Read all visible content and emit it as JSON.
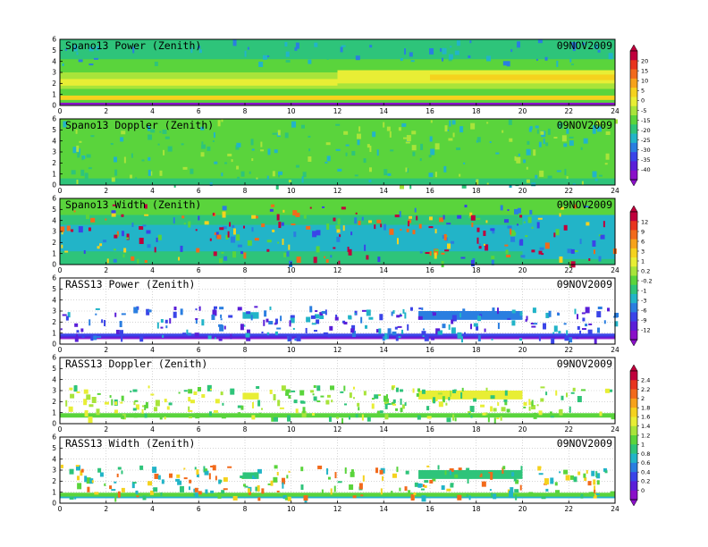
{
  "chart_data": {
    "type": "heatmap",
    "date_label": "09NOV2009",
    "x_ticks": [
      0,
      2,
      4,
      6,
      8,
      10,
      12,
      14,
      16,
      18,
      20,
      22,
      24
    ],
    "y_ticks": [
      0,
      1,
      2,
      3,
      4,
      5,
      6
    ],
    "xlim": [
      0,
      24
    ],
    "ylim": [
      0,
      6
    ],
    "colorbars": [
      {
        "id": "spano",
        "ticks": [
          "20",
          "15",
          "10",
          "5",
          "0",
          "-5",
          "-15",
          "-20",
          "-25",
          "-30",
          "-35",
          "-40"
        ],
        "colors": [
          "#c0003c",
          "#e8341e",
          "#f26a1b",
          "#f7a21b",
          "#f5d21e",
          "#e8ee35",
          "#a8e43a",
          "#5ad43c",
          "#2ec47a",
          "#22b4c8",
          "#2a7ee0",
          "#3a44e8",
          "#5a1ed8",
          "#8a10c8"
        ]
      },
      {
        "id": "rass_power",
        "ticks": [
          "12",
          "9",
          "6",
          "3",
          "1",
          "0.2",
          "-0.2",
          "-1",
          "-3",
          "-6",
          "-9",
          "-12"
        ],
        "colors": [
          "#c0003c",
          "#e8341e",
          "#f26a1b",
          "#f7a21b",
          "#f5d21e",
          "#e8ee35",
          "#a8e43a",
          "#5ad43c",
          "#2ec47a",
          "#22b4c8",
          "#2a7ee0",
          "#3a44e8",
          "#5a1ed8",
          "#8a10c8"
        ]
      },
      {
        "id": "rass_doppler",
        "ticks": [
          "2.4",
          "2.2",
          "2",
          "1.8",
          "1.6",
          "1.4",
          "1.2",
          "1",
          "0.8",
          "0.6",
          "0.4",
          "0.2",
          "0"
        ],
        "colors": [
          "#c0003c",
          "#e8341e",
          "#f26a1b",
          "#f7a21b",
          "#f5d21e",
          "#e8ee35",
          "#a8e43a",
          "#5ad43c",
          "#2ec47a",
          "#22b4c8",
          "#2a7ee0",
          "#3a44e8",
          "#5a1ed8",
          "#8a10c8"
        ]
      }
    ],
    "panels": [
      {
        "title": "Spano13 Power (Zenith)",
        "layers": [
          {
            "x": [
              0,
              24
            ],
            "y": [
              0.2,
              6
            ],
            "color": "#5ad43c"
          },
          {
            "x": [
              0,
              24
            ],
            "y": [
              4.2,
              6
            ],
            "color": "#2ec47a"
          },
          {
            "x": [
              0,
              24
            ],
            "y": [
              1.5,
              3.0
            ],
            "color": "#a8e43a"
          },
          {
            "x": [
              0,
              12
            ],
            "y": [
              1.8,
              2.4
            ],
            "color": "#e8ee35"
          },
          {
            "x": [
              12,
              24
            ],
            "y": [
              2.0,
              3.2
            ],
            "color": "#e8ee35"
          },
          {
            "x": [
              16,
              24
            ],
            "y": [
              2.3,
              2.8
            ],
            "color": "#f5d21e"
          },
          {
            "x": [
              0,
              24
            ],
            "y": [
              0.5,
              0.9
            ],
            "color": "#f5d21e"
          },
          {
            "x": [
              0,
              24
            ],
            "y": [
              0.05,
              0.25
            ],
            "color": "#8a10c8"
          }
        ],
        "speckle": {
          "colors": [
            "#2ec47a",
            "#22b4c8",
            "#2a7ee0"
          ],
          "count": 90,
          "y": [
            3.8,
            6
          ]
        }
      },
      {
        "title": "Spano13 Doppler (Zenith)",
        "layers": [
          {
            "x": [
              0,
              24
            ],
            "y": [
              0,
              6
            ],
            "color": "#5ad43c"
          },
          {
            "x": [
              0,
              24
            ],
            "y": [
              0,
              0.6
            ],
            "color": "#2ec47a"
          }
        ],
        "speckle": {
          "colors": [
            "#a8e43a",
            "#2ec47a",
            "#22b4c8"
          ],
          "count": 220,
          "y": [
            0,
            6
          ]
        }
      },
      {
        "title": "Spano13 Width (Zenith)",
        "layers": [
          {
            "x": [
              0,
              24
            ],
            "y": [
              0,
              6
            ],
            "color": "#2ec47a"
          },
          {
            "x": [
              0,
              24
            ],
            "y": [
              4.5,
              6
            ],
            "color": "#5ad43c"
          },
          {
            "x": [
              0,
              24
            ],
            "y": [
              1.2,
              3.6
            ],
            "color": "#22b4c8"
          },
          {
            "x": [
              20,
              24
            ],
            "y": [
              0.5,
              4.5
            ],
            "color": "#22b4c8"
          }
        ],
        "speckle": {
          "colors": [
            "#2a7ee0",
            "#3a44e8",
            "#f5d21e",
            "#f26a1b",
            "#c0003c",
            "#5ad43c"
          ],
          "count": 260,
          "y": [
            0.3,
            5.5
          ]
        }
      },
      {
        "title": "RASS13 Power (Zenith)",
        "layers": [
          {
            "x": [
              0,
              24
            ],
            "y": [
              0.55,
              0.95
            ],
            "color": "#3a44e8"
          },
          {
            "x": [
              0,
              24
            ],
            "y": [
              0.55,
              0.7
            ],
            "color": "#5a1ed8"
          },
          {
            "x": [
              0,
              24
            ],
            "y": [
              0.45,
              0.55
            ],
            "color": "#8a10c8"
          },
          {
            "x": [
              15.5,
              20
            ],
            "y": [
              2.2,
              3.0
            ],
            "color": "#2a7ee0"
          },
          {
            "x": [
              7.9,
              8.6
            ],
            "y": [
              2.3,
              2.9
            ],
            "color": "#22b4c8"
          }
        ],
        "speckle": {
          "colors": [
            "#3a44e8",
            "#2a7ee0",
            "#5a1ed8",
            "#22b4c8"
          ],
          "count": 230,
          "y": [
            0.5,
            3.5
          ]
        }
      },
      {
        "title": "RASS13 Doppler (Zenith)",
        "layers": [
          {
            "x": [
              0,
              24
            ],
            "y": [
              0.55,
              0.95
            ],
            "color": "#5ad43c"
          },
          {
            "x": [
              15.5,
              20
            ],
            "y": [
              2.2,
              3.0
            ],
            "color": "#e8ee35"
          },
          {
            "x": [
              7.9,
              8.6
            ],
            "y": [
              2.2,
              2.8
            ],
            "color": "#e8ee35"
          }
        ],
        "speckle": {
          "colors": [
            "#a8e43a",
            "#e8ee35",
            "#5ad43c",
            "#2ec47a"
          ],
          "count": 230,
          "y": [
            0.5,
            3.5
          ]
        }
      },
      {
        "title": "RASS13 Width (Zenith)",
        "layers": [
          {
            "x": [
              0,
              24
            ],
            "y": [
              0.55,
              0.95
            ],
            "color": "#5ad43c"
          },
          {
            "x": [
              0,
              24
            ],
            "y": [
              0.45,
              0.6
            ],
            "color": "#22b4c8"
          },
          {
            "x": [
              15.5,
              20
            ],
            "y": [
              2.2,
              3.0
            ],
            "color": "#2ec47a"
          },
          {
            "x": [
              7.9,
              8.6
            ],
            "y": [
              2.2,
              2.8
            ],
            "color": "#2ec47a"
          }
        ],
        "speckle": {
          "colors": [
            "#5ad43c",
            "#f26a1b",
            "#f5d21e",
            "#2ec47a",
            "#22b4c8"
          ],
          "count": 230,
          "y": [
            0.5,
            3.5
          ]
        }
      }
    ]
  }
}
